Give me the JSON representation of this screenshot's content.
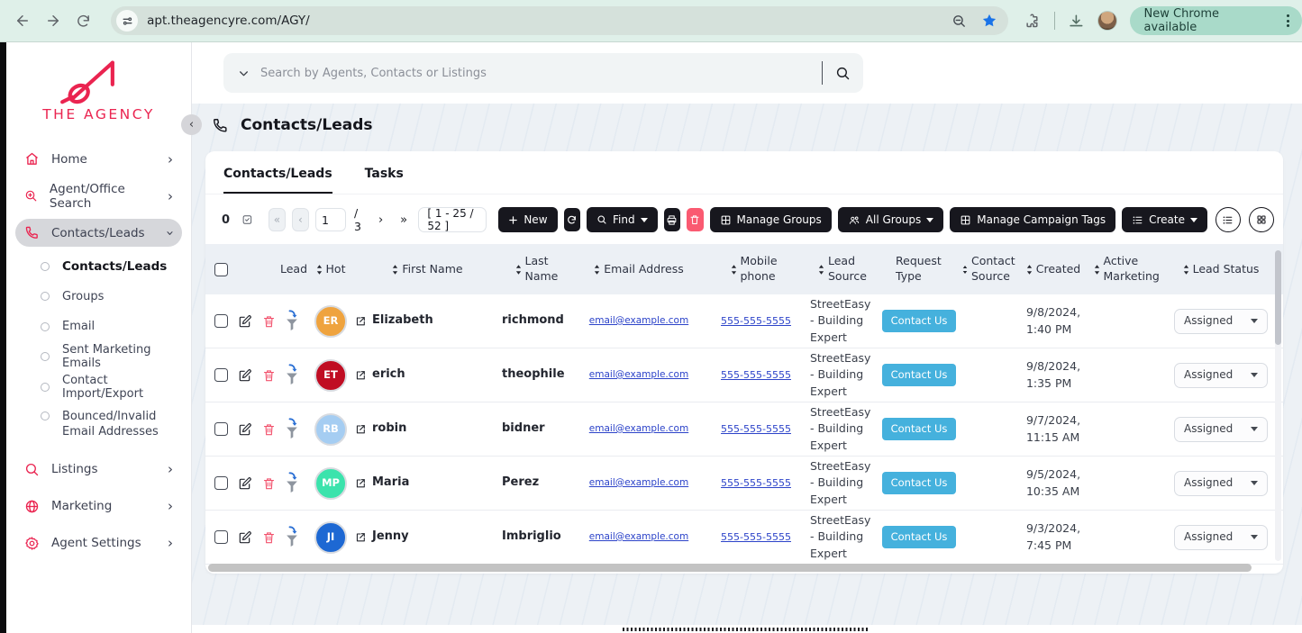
{
  "browser": {
    "url": "apt.theagencyre.com/AGY/",
    "update_button": "New Chrome available"
  },
  "search": {
    "placeholder": "Search by Agents, Contacts or Listings"
  },
  "page": {
    "title": "Contacts/Leads"
  },
  "sidebar": {
    "logo_text": "THE AGENCY",
    "items": [
      {
        "label": "Home"
      },
      {
        "label": "Agent/Office Search"
      },
      {
        "label": "Contacts/Leads"
      },
      {
        "label": "Listings"
      },
      {
        "label": "Marketing"
      },
      {
        "label": "Agent Settings"
      }
    ],
    "subitems": [
      {
        "label": "Contacts/Leads"
      },
      {
        "label": "Groups"
      },
      {
        "label": "Email"
      },
      {
        "label": "Sent Marketing Emails"
      },
      {
        "label": "Contact Import/Export"
      },
      {
        "label": "Bounced/Invalid Email Addresses"
      }
    ]
  },
  "tabs": [
    {
      "label": "Contacts/Leads"
    },
    {
      "label": "Tasks"
    }
  ],
  "toolbar": {
    "selected_count": "0",
    "pagination": {
      "page": "1",
      "of": "/ 3",
      "range": "[ 1 - 25 / 52 ]"
    },
    "new_label": "New",
    "find_label": "Find",
    "manage_groups_label": "Manage Groups",
    "all_groups_label": "All Groups",
    "manage_campaign_tags_label": "Manage Campaign Tags",
    "create_label": "Create"
  },
  "table": {
    "headers": {
      "lead": "Lead",
      "hot": "Hot",
      "first_name": "First Name",
      "last_name": "Last Name",
      "email": "Email Address",
      "mobile": "Mobile phone",
      "lead_source": "Lead Source",
      "request_type": "Request Type",
      "contact_source": "Contact Source",
      "created": "Created",
      "active_marketing": "Active Marketing",
      "lead_status": "Lead Status"
    },
    "rows": [
      {
        "initials": "ER",
        "avatar_color": "#EFA33E",
        "first_name": "Elizabeth",
        "last_name": "richmond",
        "email": "email@example.com",
        "mobile": "555-555-5555",
        "lead_source": "StreetEasy - Building Expert",
        "request_type": "Contact Us",
        "created_date": "9/8/2024,",
        "created_time": "1:40 PM",
        "lead_status": "Assigned"
      },
      {
        "initials": "ET",
        "avatar_color": "#C00D23",
        "first_name": "erich",
        "last_name": "theophile",
        "email": "email@example.com",
        "mobile": "555-555-5555",
        "lead_source": "StreetEasy - Building Expert",
        "request_type": "Contact Us",
        "created_date": "9/8/2024,",
        "created_time": "1:35 PM",
        "lead_status": "Assigned"
      },
      {
        "initials": "RB",
        "avatar_color": "#A5CDF2",
        "first_name": "robin",
        "last_name": "bidner",
        "email": "email@example.com",
        "mobile": "555-555-5555",
        "lead_source": "StreetEasy - Building Expert",
        "request_type": "Contact Us",
        "created_date": "9/7/2024,",
        "created_time": "11:15 AM",
        "lead_status": "Assigned"
      },
      {
        "initials": "MP",
        "avatar_color": "#3BE3AC",
        "first_name": "Maria",
        "last_name": "Perez",
        "email": "email@example.com",
        "mobile": "555-555-5555",
        "lead_source": "StreetEasy - Building Expert",
        "request_type": "Contact Us",
        "created_date": "9/5/2024,",
        "created_time": "10:35 AM",
        "lead_status": "Assigned"
      },
      {
        "initials": "JI",
        "avatar_color": "#1D68D3",
        "first_name": "Jenny",
        "last_name": "Imbriglio",
        "email": "email@example.com",
        "mobile": "555-555-5555",
        "lead_source": "StreetEasy - Building Expert",
        "request_type": "Contact Us",
        "created_date": "9/3/2024,",
        "created_time": "7:45 PM",
        "lead_status": "Assigned"
      }
    ]
  },
  "colors": {
    "accent_red": "#EA2450",
    "badge_blue": "#45B1DD",
    "button_dark": "#17171E",
    "delete_red": "#FA5A71",
    "link_blue": "#2C43C9",
    "page_bg": "#EDF1F5",
    "chrome_bg": "#DFF0E9"
  }
}
